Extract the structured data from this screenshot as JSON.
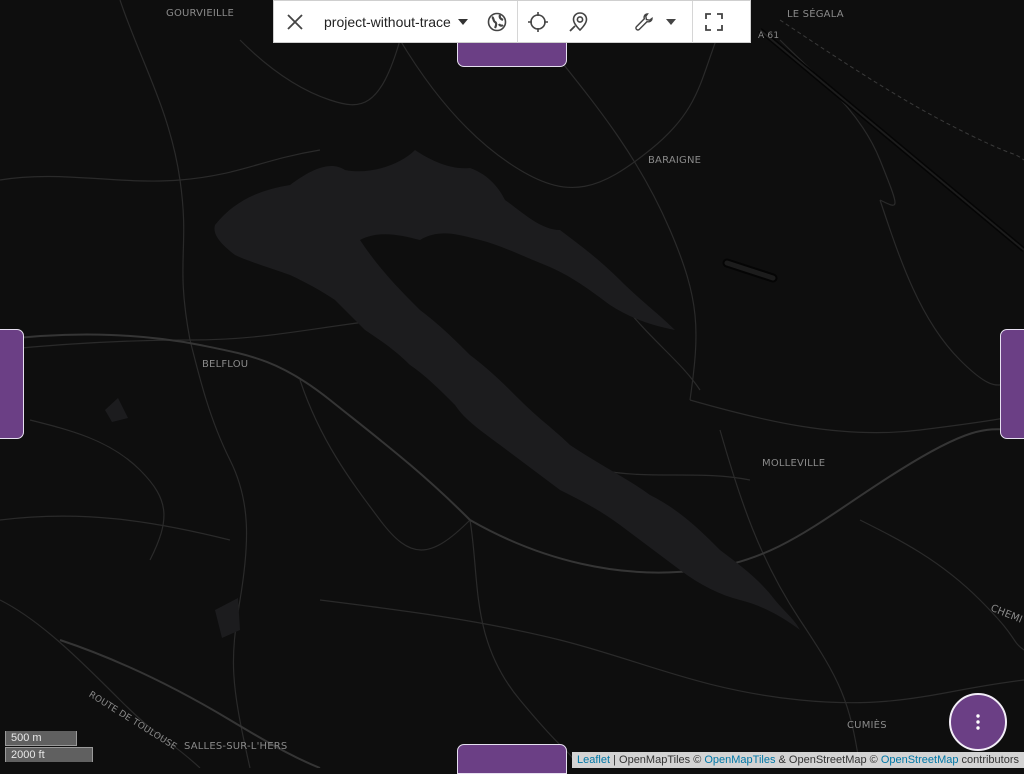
{
  "toolbar": {
    "project_name": "project-without-trace",
    "close_icon": "close-icon",
    "project_dropdown_icon": "caret-down-icon",
    "layers_icon": "globe-icon",
    "locate_icon": "crosshair-icon",
    "search_place_icon": "location-search-icon",
    "tools_icon": "wrench-icon",
    "tools_dropdown_icon": "caret-down-icon",
    "fullscreen_icon": "fullscreen-icon"
  },
  "map": {
    "theme": "dark",
    "background_color": "#0e0e0e",
    "lake_color": "#1c1c1e",
    "road_color": "#2e2e2e",
    "places": {
      "gourvieille": "GOURVIEILLE",
      "le_segala": "LE SÉGALA",
      "baraigne": "BARAIGNE",
      "belflou": "BELFLOU",
      "molleville": "MOLLEVILLE",
      "cumies": "CUMIÈS",
      "salles_sur_lhers": "SALLES-SUR-L'HERS",
      "route_de_toulouse": "ROUTE DE TOULOUSE",
      "chemin": "CHEMI",
      "a61": "A 61"
    }
  },
  "panels": {
    "accent_color": "#6b3f85"
  },
  "fab": {
    "icon": "more-vertical-icon"
  },
  "scale": {
    "metric": "500 m",
    "imperial": "2000 ft"
  },
  "attribution": {
    "leaflet": "Leaflet",
    "sep1": " | OpenMapTiles © ",
    "openmaptiles": "OpenMapTiles",
    "sep2": " & OpenStreetMap © ",
    "openstreetmap": "OpenStreetMap",
    "contributors": " contributors"
  }
}
